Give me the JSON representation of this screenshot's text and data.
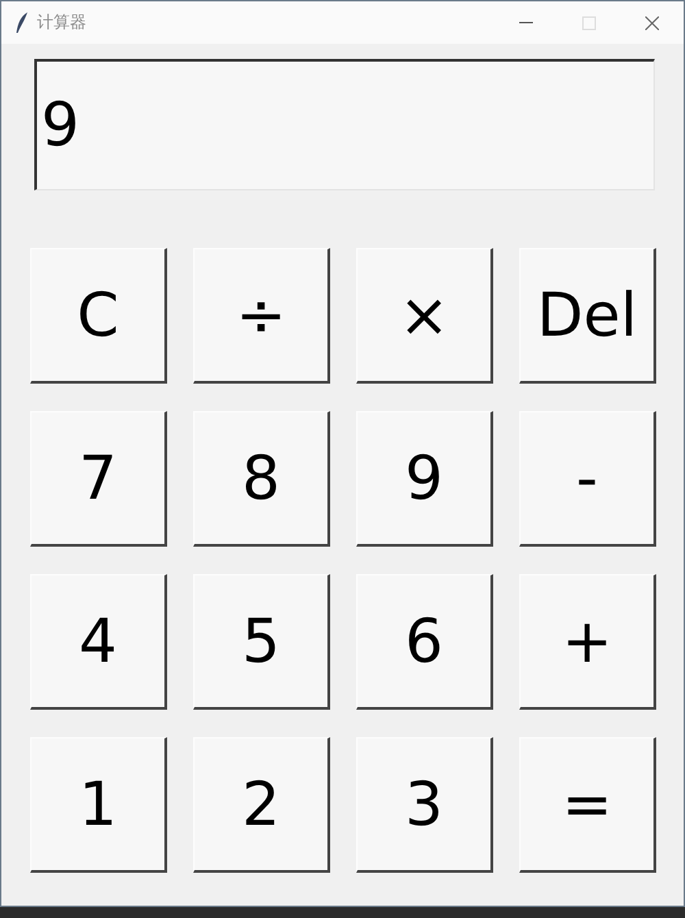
{
  "window": {
    "title": "计算器"
  },
  "display": {
    "value": "9"
  },
  "keys": [
    {
      "label": "C"
    },
    {
      "label": "÷"
    },
    {
      "label": "×"
    },
    {
      "label": "Del"
    },
    {
      "label": "7"
    },
    {
      "label": "8"
    },
    {
      "label": "9"
    },
    {
      "label": "-"
    },
    {
      "label": "4"
    },
    {
      "label": "5"
    },
    {
      "label": "6"
    },
    {
      "label": "+"
    },
    {
      "label": "1"
    },
    {
      "label": "2"
    },
    {
      "label": "3"
    },
    {
      "label": "="
    }
  ]
}
